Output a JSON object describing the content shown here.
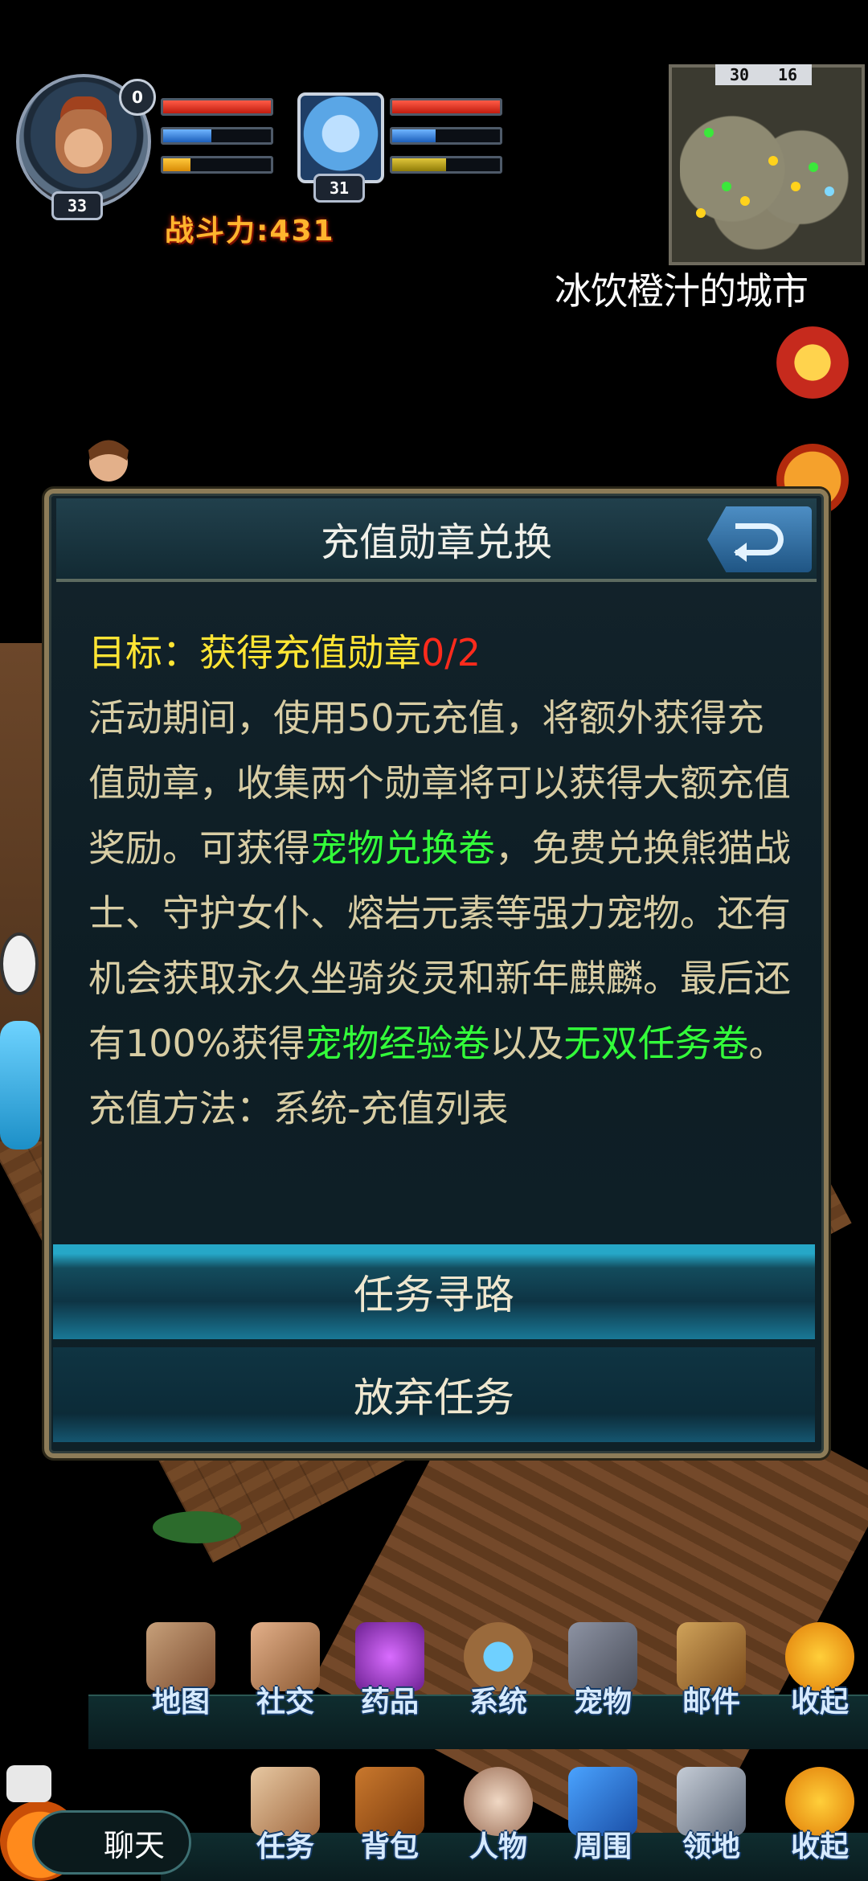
{
  "hud": {
    "player_level": "33",
    "notification_count": "0",
    "pet_level": "31",
    "power_label": "战斗力:431",
    "player_hp": 1.0,
    "player_mp": 0.45,
    "player_exp": 0.25,
    "pet_hp": 1.0,
    "pet_mp": 0.4,
    "pet_exp": 0.5
  },
  "minimap": {
    "coord_x": "30",
    "coord_y": "16",
    "city_name": "冰饮橙汁的城市"
  },
  "dialog": {
    "title": "充值勋章兑换",
    "goal_prefix": "目标：",
    "goal_verb": "获得",
    "goal_item": "充值勋章",
    "goal_progress": "0/2",
    "p1": "活动期间，使用50元充值，将额外获得充值勋章，收集两个勋章将可以获得大额充值奖励。可获得",
    "link_exchange": "宠物兑换卷",
    "p2": "，免费兑换熊猫战士、守护女仆、熔岩元素等强力宠物。还有机会获取永久坐骑炎灵和新年麒麟。最后还有100%获得",
    "link_exp": "宠物经验卷",
    "p3": "以及",
    "link_task": "无双任务卷",
    "p4": "。充值方法：系统-充值列表",
    "btn_path": "任务寻路",
    "btn_abandon": "放弃任务"
  },
  "menu_row1": [
    "地图",
    "社交",
    "药品",
    "系统",
    "宠物",
    "邮件",
    "收起"
  ],
  "menu_row2": [
    "任务",
    "背包",
    "人物",
    "周围",
    "领地",
    "收起"
  ],
  "chat_label": "聊天",
  "colors": {
    "goal_yellow": "#ffe534",
    "progress_red": "#ff2b1c",
    "link_green": "#33ff3a",
    "power_orange": "#ffb52e"
  }
}
